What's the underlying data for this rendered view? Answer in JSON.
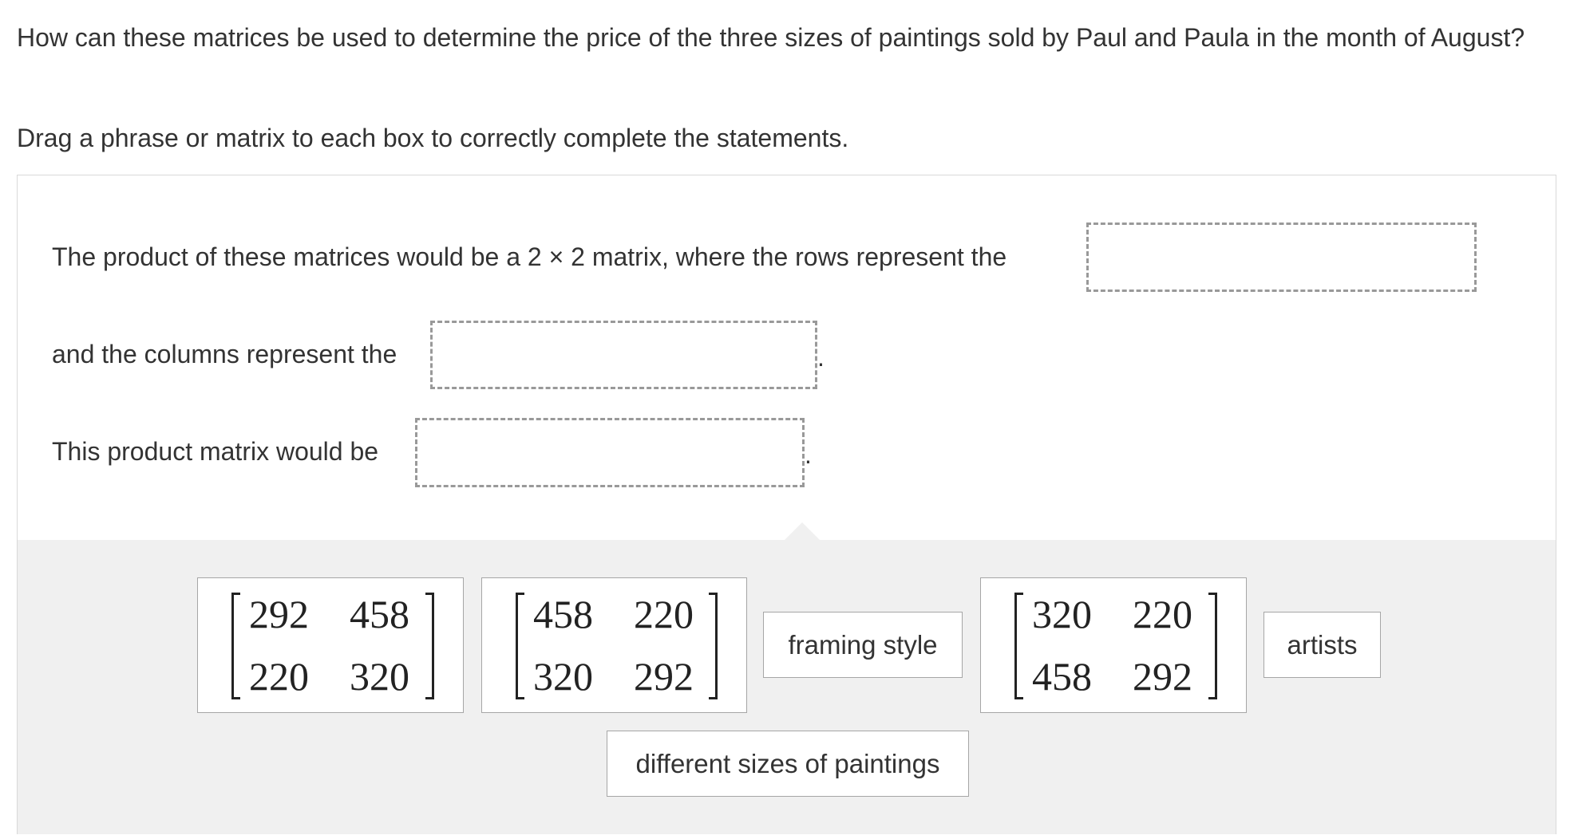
{
  "question": "How can these matrices be used to determine the price of the three sizes of paintings sold by Paul and Paula in the month of August?",
  "instruction": "Drag a phrase or matrix to each box to correctly complete the statements.",
  "statements": {
    "s1": "The product of these matrices would be a 2 × 2 matrix, where the rows represent the",
    "s2": "and the columns represent the",
    "s3": "This product matrix would be",
    "period": "."
  },
  "choices": {
    "matrix_a": [
      [
        "292",
        "458"
      ],
      [
        "220",
        "320"
      ]
    ],
    "matrix_b": [
      [
        "458",
        "220"
      ],
      [
        "320",
        "292"
      ]
    ],
    "framing_style": "framing style",
    "matrix_c": [
      [
        "320",
        "220"
      ],
      [
        "458",
        "292"
      ]
    ],
    "artists": "artists",
    "different_sizes": "different sizes of paintings"
  }
}
